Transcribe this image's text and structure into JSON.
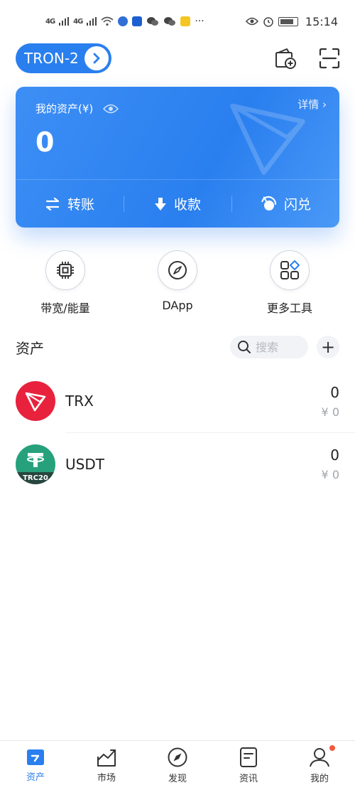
{
  "status_bar": {
    "signal1": "4G",
    "signal2": "4G",
    "time": "15:14",
    "more": "···"
  },
  "header": {
    "wallet_name": "TRON-2"
  },
  "asset_card": {
    "title": "我的资产(¥)",
    "detail": "详情 ›",
    "amount": "0",
    "actions": {
      "transfer": "转账",
      "receive": "收款",
      "swap": "闪兑"
    }
  },
  "tools": {
    "bandwidth": "带宽/能量",
    "dapp": "DApp",
    "more_tools": "更多工具"
  },
  "assets": {
    "title": "资产",
    "search_placeholder": "搜索",
    "add": "+",
    "tokens": [
      {
        "name": "TRX",
        "amount": "0",
        "fiat": "¥ 0",
        "color": "#e8223d"
      },
      {
        "name": "USDT",
        "amount": "0",
        "fiat": "¥ 0",
        "color": "#26a17b",
        "badge": "TRC20"
      }
    ]
  },
  "bottom_nav": {
    "assets": "资产",
    "market": "市场",
    "discover": "发现",
    "news": "资讯",
    "mine": "我的"
  },
  "colors": {
    "primary": "#2a7fef",
    "trx": "#e8223d",
    "usdt": "#26a17b",
    "notification": "#f05a3c"
  }
}
